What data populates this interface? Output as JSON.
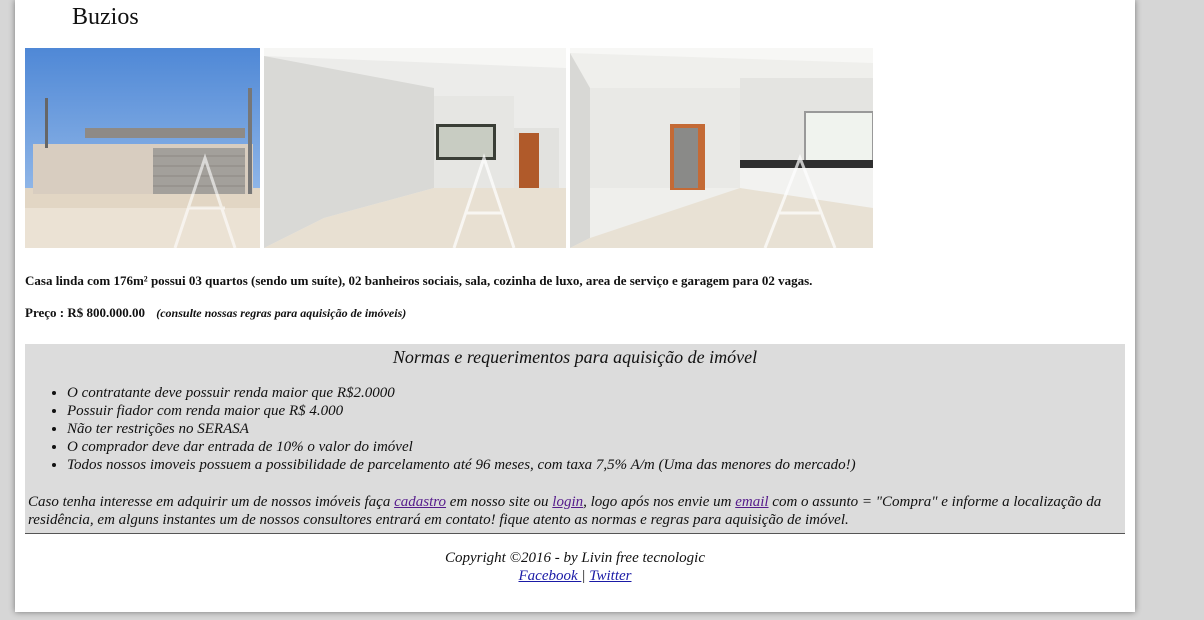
{
  "page": {
    "title": "Buzios"
  },
  "description": "Casa linda com 176m² possui 03 quartos (sendo um suíte), 02 banheiros sociais, sala, cozinha de luxo, area de serviço e garagem para 02 vagas.",
  "price": {
    "label": "Preço : R$ 800.000.00",
    "note": "(consulte nossas regras para aquisição de imóveis)"
  },
  "rules": {
    "heading": "Normas e requerimentos para aquisição de imóvel",
    "items": [
      "O contratante deve possuir renda maior que R$2.0000",
      "Possuir fiador com renda maior que R$ 4.000",
      "Não ter restrições no SERASA",
      "O comprador deve dar entrada de 10% o valor do imóvel",
      "Todos nossos imoveis possuem a possibilidade de parcelamento até 96 meses, com taxa 7,5% A/m (Uma das menores do mercado!)"
    ],
    "text_1": "Caso tenha interesse em adquirir um de nossos imóveis faça ",
    "link_cadastro": "cadastro",
    "text_2": " em nosso site ou ",
    "link_login": "login",
    "text_3": ", logo após nos envie um ",
    "link_email": "email",
    "text_4": " com o assunto = \"Compra\" e informe a localização da residência, em alguns instantes um de nossos consultores entrará em contato! fique atento as normas e regras para aquisição de imóvel."
  },
  "footer": {
    "copyright": "Copyright ©2016 - by Livin free tecnologic",
    "facebook": "Facebook ",
    "separator": "|",
    "twitter": "Twitter"
  },
  "colors": {
    "page_bg": "#d6d6d6",
    "rules_bg": "#dcdcdc",
    "link_visited": "#551a8b",
    "link": "#1a1aa6"
  }
}
